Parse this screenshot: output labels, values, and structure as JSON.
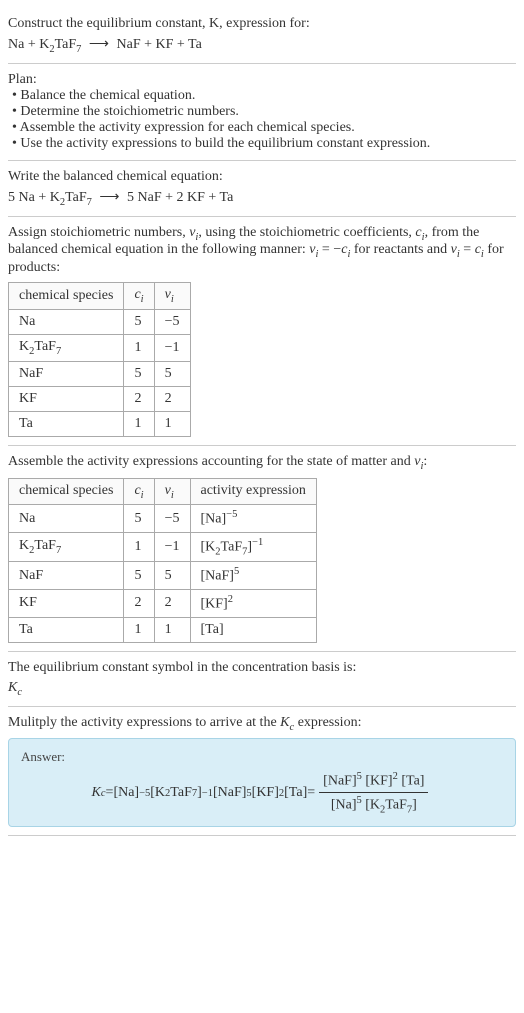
{
  "sec1": {
    "line1": "Construct the equilibrium constant, K, expression for:",
    "eq": {
      "lhs1": "Na + K",
      "sub1": "2",
      "lhs2": "TaF",
      "sub2": "7",
      "arrow": "⟶",
      "rhs": "NaF + KF + Ta"
    }
  },
  "sec2": {
    "title": "Plan:",
    "b1": "• Balance the chemical equation.",
    "b2": "• Determine the stoichiometric numbers.",
    "b3": "• Assemble the activity expression for each chemical species.",
    "b4": "• Use the activity expressions to build the equilibrium constant expression."
  },
  "sec3": {
    "title": "Write the balanced chemical equation:",
    "eq": {
      "lhs1": "5 Na + K",
      "sub1": "2",
      "lhs2": "TaF",
      "sub2": "7",
      "arrow": "⟶",
      "rhs": "5 NaF + 2 KF + Ta"
    }
  },
  "sec4": {
    "line1a": "Assign stoichiometric numbers, ",
    "nu": "ν",
    "i": "i",
    "line1b": ", using the stoichiometric coefficients, ",
    "c": "c",
    "line1c": ", from the balanced chemical equation in the following manner: ",
    "rel1": " = −",
    "line1d": " for reactants and ",
    "rel2": " = ",
    "line1e": " for products:",
    "headers": {
      "h1": "chemical species",
      "h2": "c",
      "h2sub": "i",
      "h3": "ν",
      "h3sub": "i"
    },
    "rows": [
      {
        "sp": "Na",
        "c": "5",
        "nu": "−5"
      },
      {
        "sp_parts": [
          "K",
          "2",
          "TaF",
          "7"
        ],
        "c": "1",
        "nu": "−1"
      },
      {
        "sp": "NaF",
        "c": "5",
        "nu": "5"
      },
      {
        "sp": "KF",
        "c": "2",
        "nu": "2"
      },
      {
        "sp": "Ta",
        "c": "1",
        "nu": "1"
      }
    ]
  },
  "sec5": {
    "title_a": "Assemble the activity expressions accounting for the state of matter and ",
    "nu": "ν",
    "i": "i",
    "title_b": ":",
    "headers": {
      "h1": "chemical species",
      "h2": "c",
      "h2sub": "i",
      "h3": "ν",
      "h3sub": "i",
      "h4": "activity expression"
    },
    "rows": [
      {
        "sp": "Na",
        "c": "5",
        "nu": "−5",
        "act": {
          "base": "[Na]",
          "exp": "−5"
        }
      },
      {
        "sp_parts": [
          "K",
          "2",
          "TaF",
          "7"
        ],
        "c": "1",
        "nu": "−1",
        "act": {
          "base_parts": [
            "[K",
            "2",
            "TaF",
            "7",
            "]"
          ],
          "exp": "−1"
        }
      },
      {
        "sp": "NaF",
        "c": "5",
        "nu": "5",
        "act": {
          "base": "[NaF]",
          "exp": "5"
        }
      },
      {
        "sp": "KF",
        "c": "2",
        "nu": "2",
        "act": {
          "base": "[KF]",
          "exp": "2"
        }
      },
      {
        "sp": "Ta",
        "c": "1",
        "nu": "1",
        "act": {
          "base": "[Ta]",
          "exp": ""
        }
      }
    ]
  },
  "sec6": {
    "line1": "The equilibrium constant symbol in the concentration basis is:",
    "K": "K",
    "c": "c"
  },
  "sec7": {
    "title_a": "Mulitply the activity expressions to arrive at the ",
    "K": "K",
    "c": "c",
    "title_b": " expression:"
  },
  "answer": {
    "label": "Answer:",
    "K": "K",
    "c": "c",
    "eq": " = ",
    "t1": "[Na]",
    "e1": "−5",
    "sp": " ",
    "t2a": "[K",
    "t2sub1": "2",
    "t2b": "TaF",
    "t2sub2": "7",
    "t2c": "]",
    "e2": "−1",
    "t3": "[NaF]",
    "e3": "5",
    "t4": "[KF]",
    "e4": "2",
    "t5": "[Ta]",
    "eq2": " = ",
    "num": {
      "a": "[NaF]",
      "ae": "5",
      "b": "[KF]",
      "be": "2",
      "c": "[Ta]"
    },
    "den": {
      "a": "[Na]",
      "ae": "5",
      "b1": "[K",
      "bsub1": "2",
      "b2": "TaF",
      "bsub2": "7",
      "b3": "]"
    }
  }
}
